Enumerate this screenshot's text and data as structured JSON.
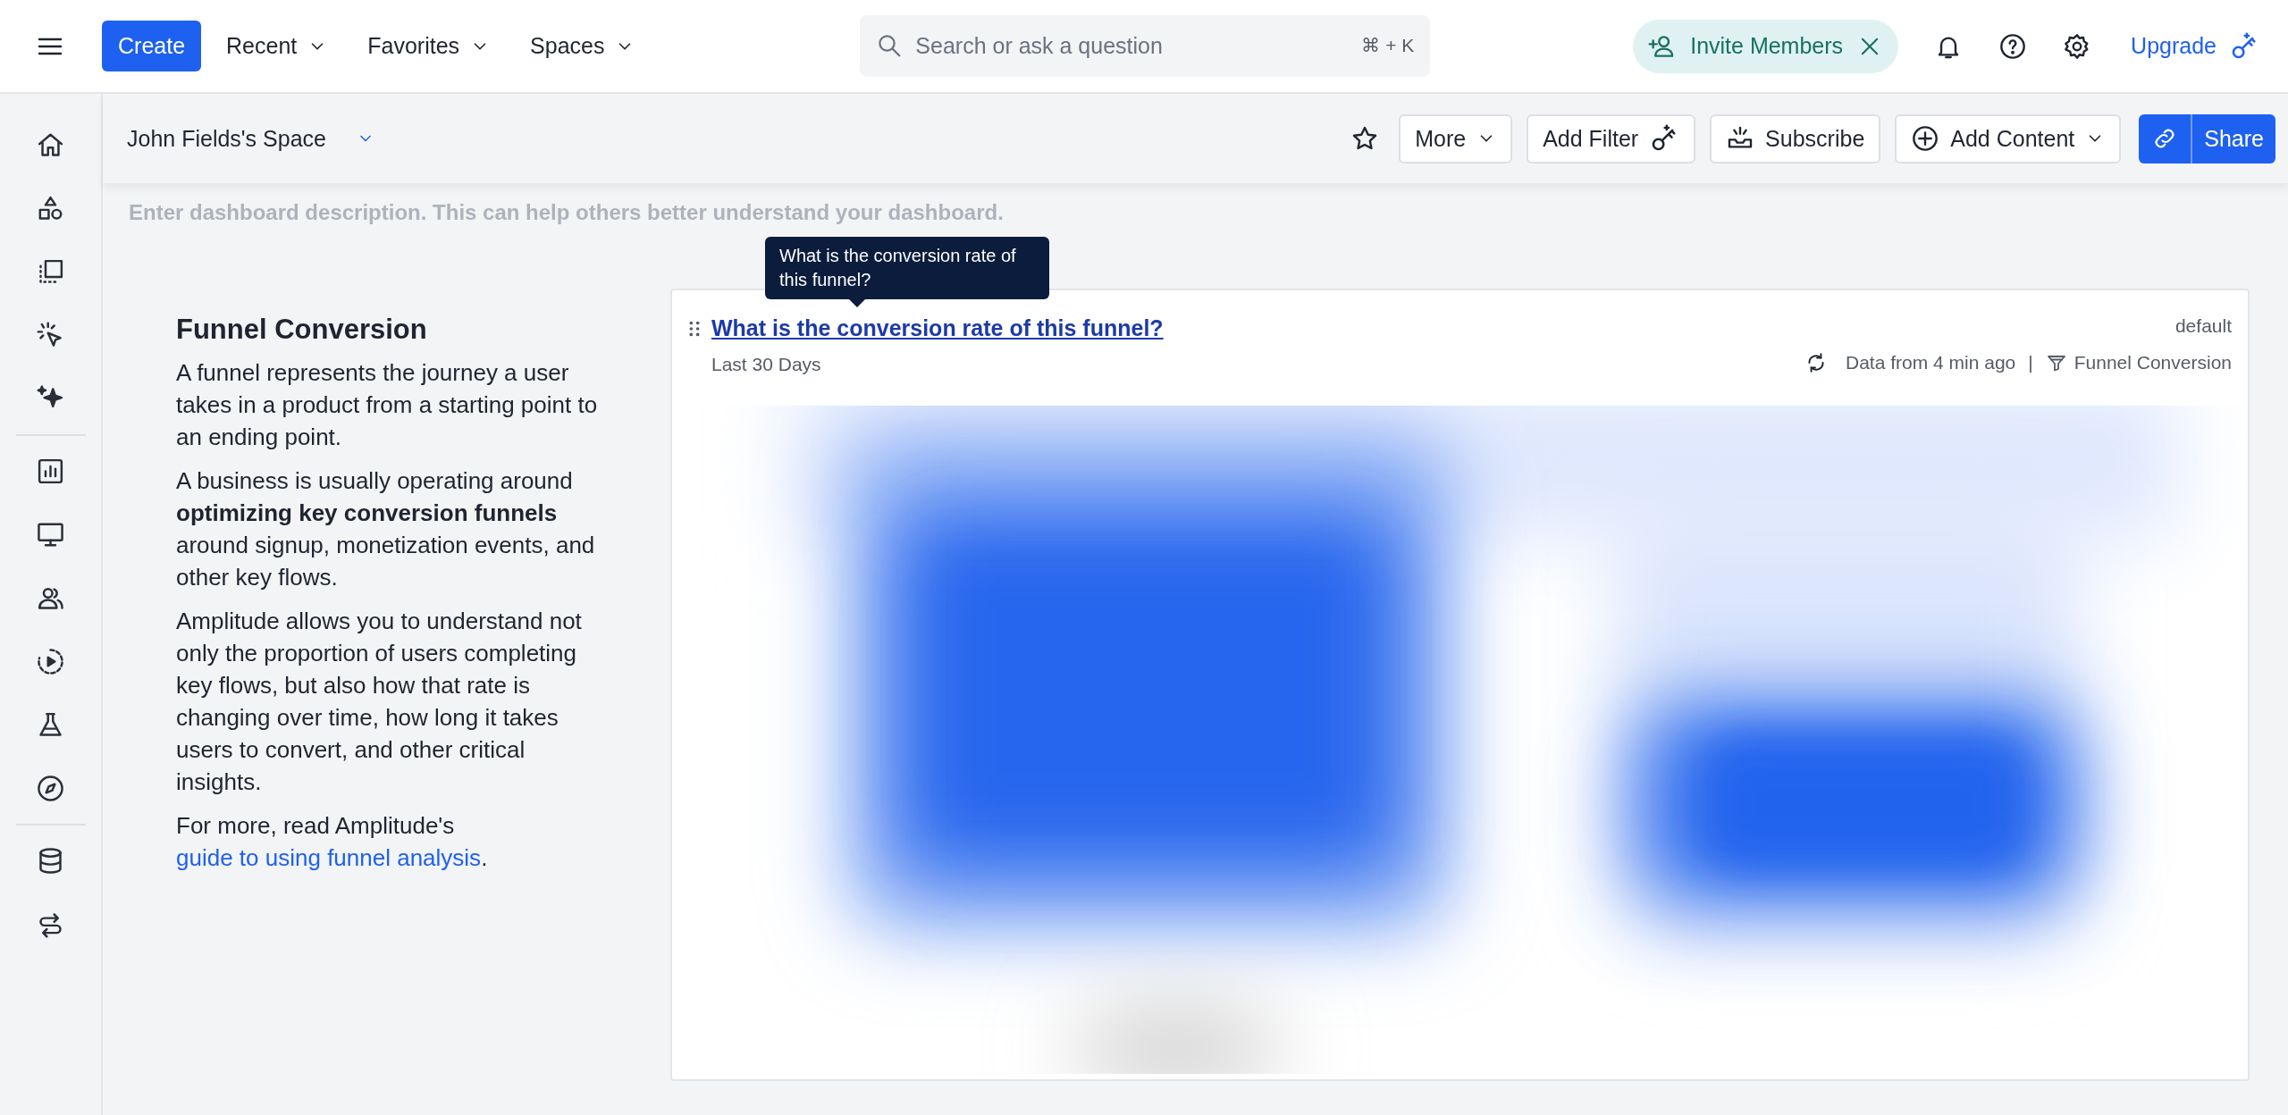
{
  "topbar": {
    "create": "Create",
    "menus": [
      {
        "label": "Recent"
      },
      {
        "label": "Favorites"
      },
      {
        "label": "Spaces"
      }
    ],
    "search": {
      "placeholder": "Search or ask a question",
      "shortcut": "⌘ + K"
    },
    "invite": "Invite Members",
    "upgrade": "Upgrade"
  },
  "toolbar": {
    "space": "John Fields's Space",
    "buttons": [
      {
        "kind": "more",
        "label": "More"
      },
      {
        "kind": "filter",
        "label": "Add Filter"
      },
      {
        "kind": "subscribe",
        "label": "Subscribe"
      },
      {
        "kind": "add",
        "label": "Add Content"
      }
    ],
    "share": "Share"
  },
  "description": {
    "placeholder": "Enter dashboard description. This can help others better understand your dashboard."
  },
  "info": {
    "title": "Funnel Conversion",
    "paragraphs": [
      {
        "text": "A funnel represents the journey a user takes in a product from a starting point to an ending point."
      },
      {
        "text": "A business is usually operating around **optimizing key conversion funnels** around signup, monetization events, and other key flows."
      },
      {
        "text": "Amplitude allows you to understand not only the proportion of users completing key flows, but also how that rate is changing over time, how long it takes users to convert, and other critical insights."
      },
      {
        "text": "For more, read Amplitude's ",
        "link": "guide to using funnel analysis",
        "tail": "."
      }
    ]
  },
  "card": {
    "tooltip": "What is the conversion rate of this funnel?",
    "title": "What is the conversion rate of this funnel?",
    "range": "Last 30 Days",
    "tag": "default",
    "freshness": "Data from 4 min ago",
    "separator": "|",
    "chart_type": "Funnel Conversion"
  }
}
